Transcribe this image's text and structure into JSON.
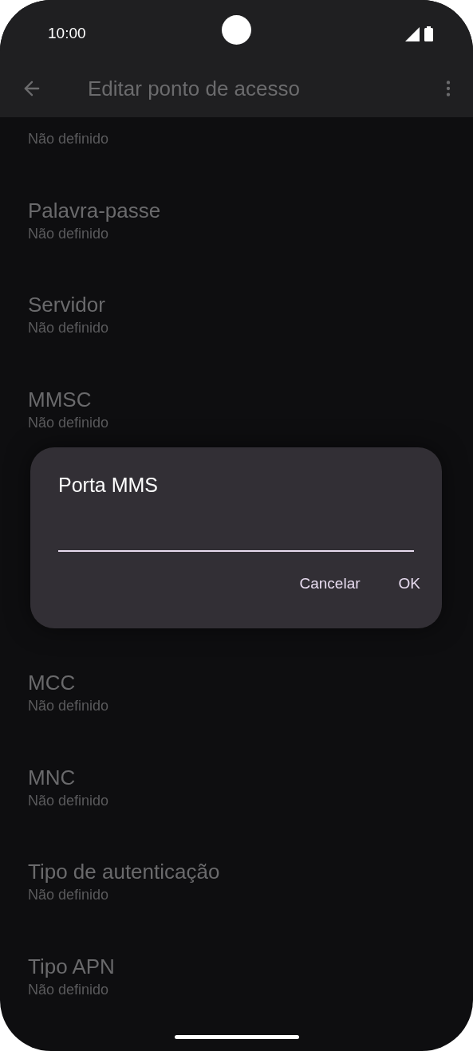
{
  "status_bar": {
    "time": "10:00"
  },
  "toolbar": {
    "title": "Editar ponto de acesso"
  },
  "settings_above_dialog": [
    {
      "value": "Não definido"
    },
    {
      "title": "Palavra-passe",
      "value": "Não definido"
    },
    {
      "title": "Servidor",
      "value": "Não definido"
    },
    {
      "title": "MMSC",
      "value": "Não definido"
    }
  ],
  "settings_below_dialog": [
    {
      "title": "MCC",
      "value": "Não definido"
    },
    {
      "title": "MNC",
      "value": "Não definido"
    },
    {
      "title": "Tipo de autenticação",
      "value": "Não definido"
    },
    {
      "title": "Tipo APN",
      "value": "Não definido"
    }
  ],
  "dialog": {
    "title": "Porta MMS",
    "buttons": [
      "Cancelar",
      "OK"
    ]
  }
}
